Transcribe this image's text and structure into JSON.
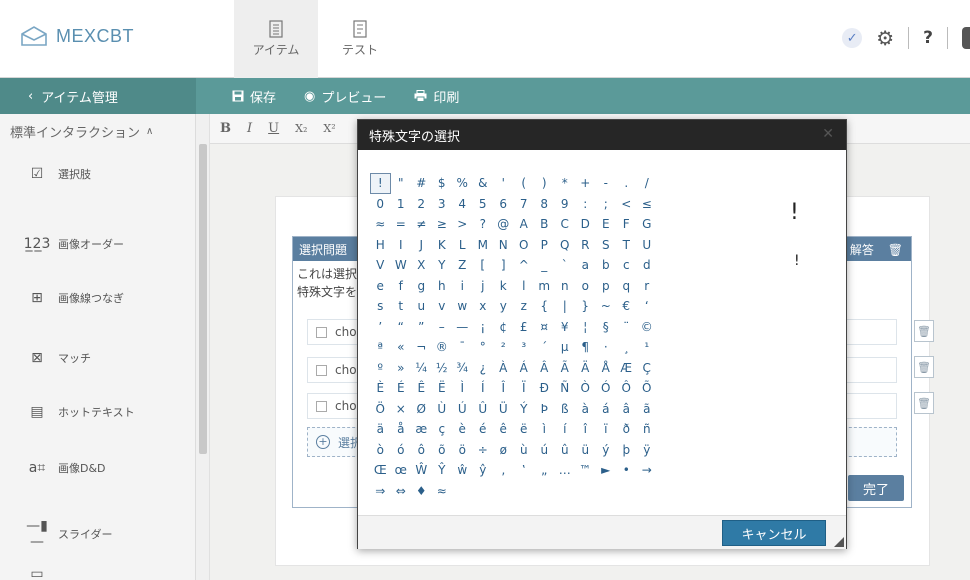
{
  "app": {
    "logo_text": "MEXCBT"
  },
  "topnav": [
    {
      "label": "アイテム",
      "icon": "document-icon"
    },
    {
      "label": "テスト",
      "icon": "test-sheet-icon"
    }
  ],
  "toolbar": {
    "back_label": "アイテム管理",
    "save_label": "保存",
    "preview_label": "プレビュー",
    "print_label": "印刷"
  },
  "sidebar": {
    "header": "標準インタラクション",
    "items": [
      {
        "label": "選択肢",
        "icon": "choice-icon"
      },
      {
        "label": "画像オーダー",
        "icon": "order-icon"
      },
      {
        "label": "画像線つなぎ",
        "icon": "associate-icon"
      },
      {
        "label": "マッチ",
        "icon": "match-icon"
      },
      {
        "label": "ホットテキスト",
        "icon": "hottext-icon"
      },
      {
        "label": "画像D&D",
        "icon": "dragdrop-icon"
      },
      {
        "label": "スライダー",
        "icon": "slider-icon"
      }
    ]
  },
  "editor": {
    "format_buttons": [
      "B",
      "I",
      "U",
      "X₂",
      "X²"
    ]
  },
  "card": {
    "title": "選択問題",
    "header_right": "解答",
    "line1": "これは選択",
    "line2": "特殊文字を",
    "choices": [
      "cho",
      "cho",
      "cho"
    ],
    "add_label": "選択",
    "done_label": "完了"
  },
  "modal": {
    "title": "特殊文字の選択",
    "preview_char": "!",
    "cancel_label": "キャンセル",
    "chars": [
      "!",
      "\"",
      "#",
      "$",
      "%",
      "&",
      "'",
      "(",
      ")",
      "*",
      "+",
      "-",
      ".",
      "/",
      "0",
      "1",
      "2",
      "3",
      "4",
      "5",
      "6",
      "7",
      "8",
      "9",
      ":",
      ";",
      "<",
      "≤",
      "≈",
      "=",
      "≠",
      "≥",
      ">",
      "?",
      "@",
      "A",
      "B",
      "C",
      "D",
      "E",
      "F",
      "G",
      "H",
      "I",
      "J",
      "K",
      "L",
      "M",
      "N",
      "O",
      "P",
      "Q",
      "R",
      "S",
      "T",
      "U",
      "V",
      "W",
      "X",
      "Y",
      "Z",
      "[",
      "]",
      "^",
      "_",
      "`",
      "a",
      "b",
      "c",
      "d",
      "e",
      "f",
      "g",
      "h",
      "i",
      "j",
      "k",
      "l",
      "m",
      "n",
      "o",
      "p",
      "q",
      "r",
      "s",
      "t",
      "u",
      "v",
      "w",
      "x",
      "y",
      "z",
      "{",
      "|",
      "}",
      "~",
      "€",
      "‘",
      "’",
      "“",
      "”",
      "–",
      "—",
      "¡",
      "¢",
      "£",
      "¤",
      "¥",
      "¦",
      "§",
      "¨",
      "©",
      "ª",
      "«",
      "¬",
      "®",
      "¯",
      "°",
      "²",
      "³",
      "´",
      "µ",
      "¶",
      "·",
      "¸",
      "¹",
      "º",
      "»",
      "¼",
      "½",
      "¾",
      "¿",
      "À",
      "Á",
      "Â",
      "Ã",
      "Ä",
      "Å",
      "Æ",
      "Ç",
      "È",
      "É",
      "Ê",
      "Ë",
      "Ì",
      "Í",
      "Î",
      "Ï",
      "Ð",
      "Ñ",
      "Ò",
      "Ó",
      "Ô",
      "Õ",
      "Ö",
      "×",
      "Ø",
      "Ù",
      "Ú",
      "Û",
      "Ü",
      "Ý",
      "Þ",
      "ß",
      "à",
      "á",
      "â",
      "ã",
      "ä",
      "å",
      "æ",
      "ç",
      "è",
      "é",
      "ê",
      "ë",
      "ì",
      "í",
      "î",
      "ï",
      "ð",
      "ñ",
      "ò",
      "ó",
      "ô",
      "õ",
      "ö",
      "÷",
      "ø",
      "ù",
      "ú",
      "û",
      "ü",
      "ý",
      "þ",
      "ÿ",
      "Œ",
      "œ",
      "Ŵ",
      "Ŷ",
      "ŵ",
      "ŷ",
      "‚",
      "‛",
      "„",
      "…",
      "™",
      "►",
      "•",
      "→",
      "⇒",
      "⇔",
      "♦",
      "≈"
    ]
  },
  "colors": {
    "action_bar": "#5b9a99",
    "modal_title_bg": "#262626",
    "accent_blue": "#2f7aa6",
    "char_color": "#2b5f8a"
  }
}
